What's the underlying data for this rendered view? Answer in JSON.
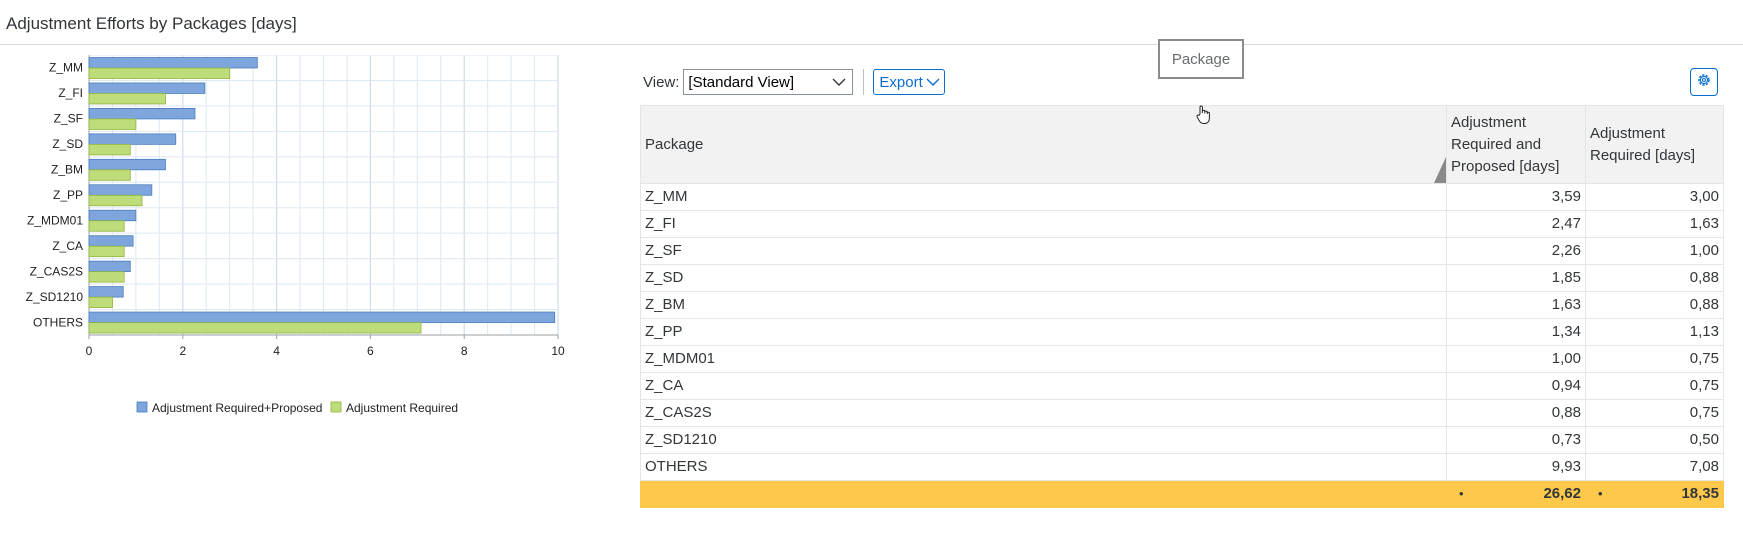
{
  "page": {
    "title": "Adjustment Efforts by Packages [days]"
  },
  "toolbar": {
    "view_label": "View:",
    "view_value": "[Standard View]",
    "export_label": "Export"
  },
  "tooltip": {
    "text": "Package"
  },
  "table": {
    "headers": {
      "package": "Package",
      "required_proposed": [
        "Adjustment",
        "Required and",
        "Proposed [days]"
      ],
      "required": [
        "Adjustment",
        "Required [days]"
      ]
    },
    "rows": [
      {
        "package": "Z_MM",
        "required_proposed": "3,59",
        "required": "3,00"
      },
      {
        "package": "Z_FI",
        "required_proposed": "2,47",
        "required": "1,63"
      },
      {
        "package": "Z_SF",
        "required_proposed": "2,26",
        "required": "1,00"
      },
      {
        "package": "Z_SD",
        "required_proposed": "1,85",
        "required": "0,88"
      },
      {
        "package": "Z_BM",
        "required_proposed": "1,63",
        "required": "0,88"
      },
      {
        "package": "Z_PP",
        "required_proposed": "1,34",
        "required": "1,13"
      },
      {
        "package": "Z_MDM01",
        "required_proposed": "1,00",
        "required": "0,75"
      },
      {
        "package": "Z_CA",
        "required_proposed": "0,94",
        "required": "0,75"
      },
      {
        "package": "Z_CAS2S",
        "required_proposed": "0,88",
        "required": "0,75"
      },
      {
        "package": "Z_SD1210",
        "required_proposed": "0,73",
        "required": "0,50"
      },
      {
        "package": "OTHERS",
        "required_proposed": "9,93",
        "required": "7,08"
      }
    ],
    "totals": {
      "dot": "•",
      "required_proposed": "26,62",
      "required": "18,35"
    },
    "total_color": "#fec84a"
  },
  "icons": {
    "dropdown": "chevron-down-icon",
    "settings": "gear-icon",
    "cursor": "hand-cursor-icon"
  },
  "chart_data": {
    "type": "bar",
    "orientation": "horizontal",
    "categories": [
      "Z_MM",
      "Z_FI",
      "Z_SF",
      "Z_SD",
      "Z_BM",
      "Z_PP",
      "Z_MDM01",
      "Z_CA",
      "Z_CAS2S",
      "Z_SD1210",
      "OTHERS"
    ],
    "series": [
      {
        "name": "Adjustment Required+Proposed",
        "color": "#7ea6dd",
        "values": [
          3.59,
          2.47,
          2.26,
          1.85,
          1.63,
          1.34,
          1.0,
          0.94,
          0.88,
          0.73,
          9.93
        ]
      },
      {
        "name": "Adjustment Required",
        "color": "#bfdc7a",
        "values": [
          3.0,
          1.63,
          1.0,
          0.88,
          0.88,
          1.13,
          0.75,
          0.75,
          0.75,
          0.5,
          7.08
        ]
      }
    ],
    "xlim": [
      0,
      10
    ],
    "xticks": [
      0,
      2,
      4,
      6,
      8,
      10
    ],
    "grid": true,
    "legend_position": "bottom"
  }
}
